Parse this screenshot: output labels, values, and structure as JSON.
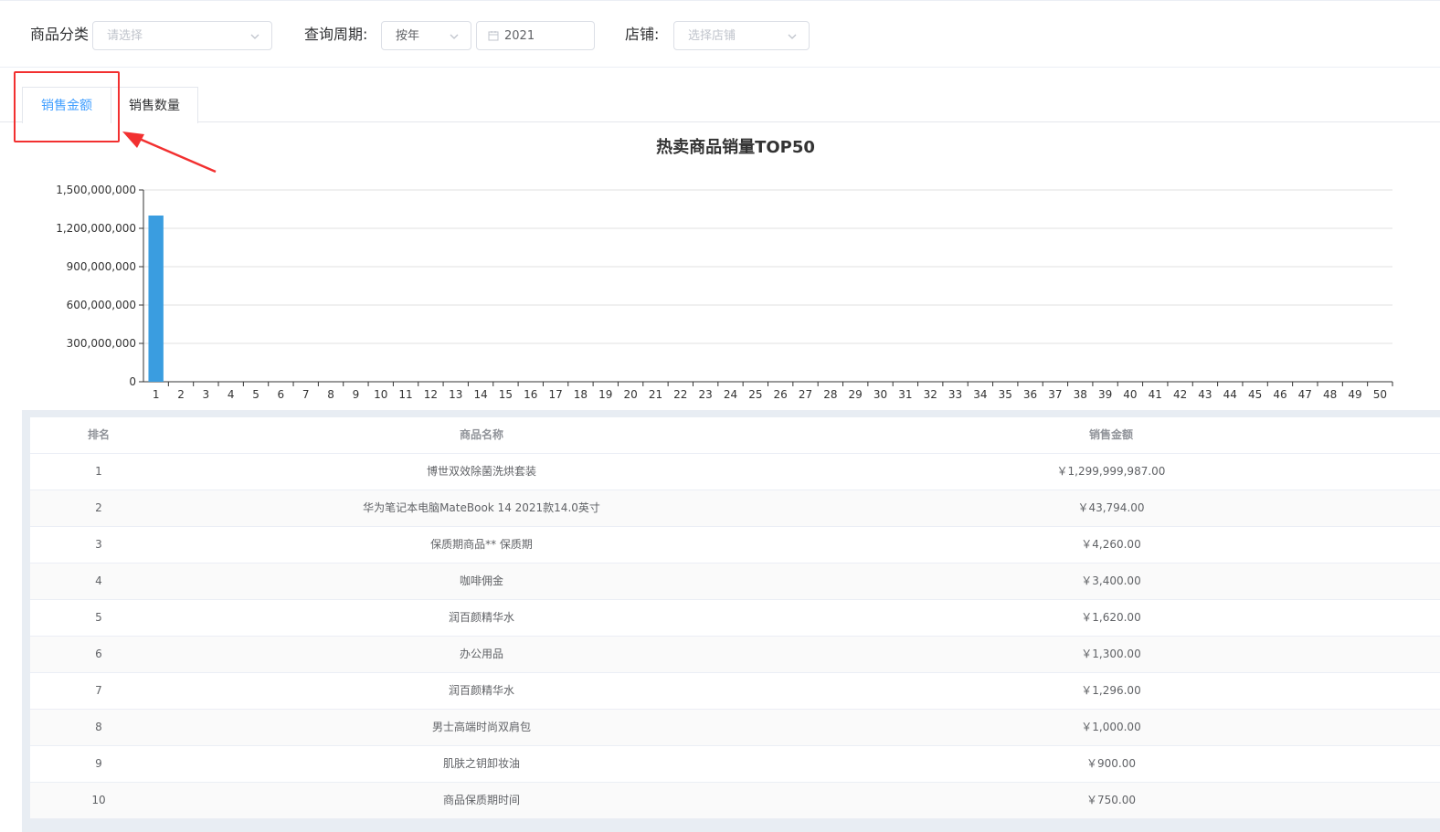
{
  "filters": {
    "category": {
      "label": "商品分类",
      "placeholder": "请选择"
    },
    "period": {
      "label": "查询周期:",
      "type_value": "按年",
      "year_value": "2021"
    },
    "store": {
      "label": "店铺:",
      "placeholder": "选择店铺"
    }
  },
  "tabs": [
    {
      "label": "销售金额",
      "active": true
    },
    {
      "label": "销售数量",
      "active": false
    }
  ],
  "colors": {
    "accent": "#409eff",
    "bar": "#3a9de0",
    "annotation": "#f23030"
  },
  "chart_data": {
    "type": "bar",
    "title": "热卖商品销量TOP50",
    "xlabel": "",
    "ylabel": "",
    "ylim": [
      0,
      1500000000
    ],
    "yticks": [
      "0",
      "300,000,000",
      "600,000,000",
      "900,000,000",
      "1,200,000,000",
      "1,500,000,000"
    ],
    "yticks_values": [
      0,
      300000000,
      600000000,
      900000000,
      1200000000,
      1500000000
    ],
    "categories": [
      "1",
      "2",
      "3",
      "4",
      "5",
      "6",
      "7",
      "8",
      "9",
      "10",
      "11",
      "12",
      "13",
      "14",
      "15",
      "16",
      "17",
      "18",
      "19",
      "20",
      "21",
      "22",
      "23",
      "24",
      "25",
      "26",
      "27",
      "28",
      "29",
      "30",
      "31",
      "32",
      "33",
      "34",
      "35",
      "36",
      "37",
      "38",
      "39",
      "40",
      "41",
      "42",
      "43",
      "44",
      "45",
      "46",
      "47",
      "48",
      "49",
      "50"
    ],
    "values": [
      1299999987,
      43794,
      4260,
      3400,
      1620,
      1300,
      1296,
      1000,
      900,
      750
    ],
    "grid": true,
    "legend": "none"
  },
  "table": {
    "headers": {
      "rank": "排名",
      "name": "商品名称",
      "amount": "销售金额"
    },
    "rows": [
      {
        "rank": "1",
        "name": "博世双效除菌洗烘套装",
        "amount": "￥1,299,999,987.00"
      },
      {
        "rank": "2",
        "name": "华为笔记本电脑MateBook 14 2021款14.0英寸",
        "amount": "￥43,794.00"
      },
      {
        "rank": "3",
        "name": "保质期商品** 保质期",
        "amount": "￥4,260.00"
      },
      {
        "rank": "4",
        "name": "咖啡佣金",
        "amount": "￥3,400.00"
      },
      {
        "rank": "5",
        "name": "润百颜精华水",
        "amount": "￥1,620.00"
      },
      {
        "rank": "6",
        "name": "办公用品",
        "amount": "￥1,300.00"
      },
      {
        "rank": "7",
        "name": "润百颜精华水",
        "amount": "￥1,296.00"
      },
      {
        "rank": "8",
        "name": "男士高端时尚双肩包",
        "amount": "￥1,000.00"
      },
      {
        "rank": "9",
        "name": "肌肤之钥卸妆油",
        "amount": "￥900.00"
      },
      {
        "rank": "10",
        "name": "商品保质期时间",
        "amount": "￥750.00"
      }
    ]
  }
}
